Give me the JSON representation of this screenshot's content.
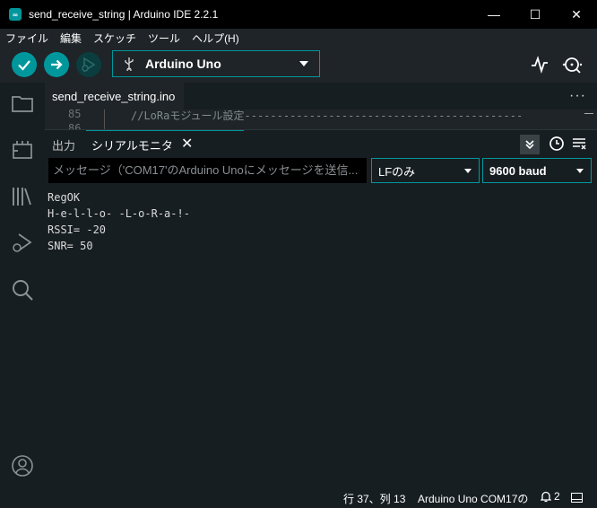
{
  "window": {
    "title": "send_receive_string | Arduino IDE 2.2.1",
    "minimize_glyph": "—",
    "maximize_glyph": "☐",
    "close_glyph": "✕"
  },
  "menu": {
    "items": [
      "ファイル",
      "編集",
      "スケッチ",
      "ツール",
      "ヘルプ(H)"
    ]
  },
  "toolbar": {
    "board_name": "Arduino Uno",
    "accent_color": "#00979c"
  },
  "editor": {
    "file_tab": "send_receive_string.ino",
    "more_label": "···",
    "line_numbers": [
      "85",
      "86"
    ],
    "visible_code": "//LoRaモジュール設定-------------------------------------------"
  },
  "panel": {
    "tabs": {
      "output": "出力",
      "serial_monitor": "シリアルモニタ",
      "close_glyph": "✕"
    },
    "input_placeholder": "メッセージ（'COM17'のArduino Unoにメッセージを送信...",
    "line_ending": "LFのみ",
    "baud_rate": "9600 baud",
    "serial_output": [
      "RegOK",
      "H-e-l-l-o- -L-o-R-a-!-",
      "RSSI= -20",
      "SNR= 50"
    ]
  },
  "status": {
    "position": "行 37、列 13",
    "board_port": "Arduino Uno COM17の",
    "notifications": "2"
  }
}
